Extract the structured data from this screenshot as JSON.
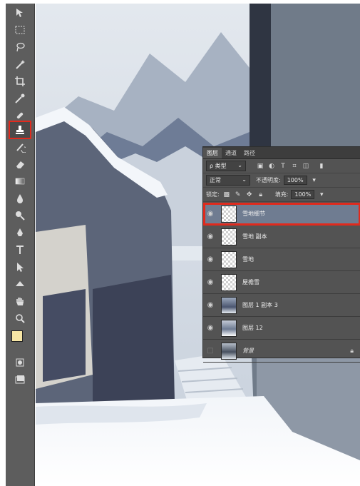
{
  "toolbar": {
    "tools": [
      {
        "name": "move-tool-icon"
      },
      {
        "name": "marquee-tool-icon"
      },
      {
        "name": "lasso-tool-icon"
      },
      {
        "name": "magic-wand-tool-icon"
      },
      {
        "name": "crop-tool-icon"
      },
      {
        "name": "eyedropper-tool-icon"
      },
      {
        "name": "healing-brush-tool-icon"
      },
      {
        "name": "brush-tool-icon"
      },
      {
        "name": "clone-stamp-tool-icon",
        "active": true
      },
      {
        "name": "history-brush-tool-icon"
      },
      {
        "name": "eraser-tool-icon"
      },
      {
        "name": "gradient-tool-icon"
      },
      {
        "name": "blur-tool-icon"
      },
      {
        "name": "dodge-tool-icon"
      },
      {
        "name": "pen-tool-icon"
      },
      {
        "name": "type-tool-icon"
      },
      {
        "name": "path-selection-tool-icon"
      },
      {
        "name": "shape-tool-icon"
      },
      {
        "name": "hand-tool-icon"
      },
      {
        "name": "zoom-tool-icon"
      }
    ]
  },
  "layers_panel": {
    "tabs": [
      "图层",
      "通道",
      "路径"
    ],
    "filter": {
      "label": "ρ 类型",
      "arrow": "⌄"
    },
    "blend_mode": "正常",
    "opacity_label": "不透明度:",
    "opacity_value": "100%",
    "lock_label": "锁定:",
    "fill_label": "填充:",
    "fill_value": "100%",
    "layers": [
      {
        "name": "雪地细节",
        "thumb": "trans",
        "selected": true
      },
      {
        "name": "雪地 副本",
        "thumb": "trans"
      },
      {
        "name": "雪地",
        "thumb": "trans"
      },
      {
        "name": "屋檐雪",
        "thumb": "trans"
      },
      {
        "name": "图层 1 副本 3",
        "thumb": "photo1"
      },
      {
        "name": "图层 12",
        "thumb": "photo2"
      },
      {
        "name": "背景",
        "thumb": "photo3",
        "locked": true
      }
    ]
  },
  "colors": {
    "toolbar_bg": "#5d5d5d",
    "panel_bg": "#535353",
    "highlight_red": "#e02a1d",
    "selected_layer": "#6f7c91"
  }
}
